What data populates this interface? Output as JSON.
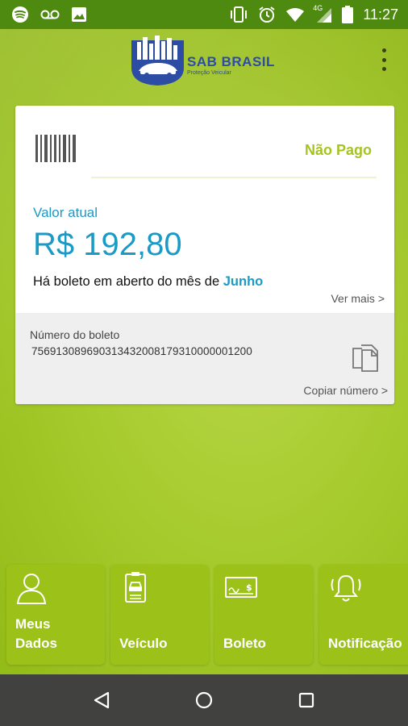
{
  "status_bar": {
    "time": "11:27",
    "signal": "4G",
    "icons_left": [
      "spotify-icon",
      "voicemail-icon",
      "image-icon"
    ],
    "icons_right": [
      "vibrate-icon",
      "alarm-icon",
      "wifi-icon",
      "signal-icon",
      "battery-icon"
    ]
  },
  "header": {
    "logo_text": "SAB BRASIL",
    "logo_subtitle": "Proteção Veicular"
  },
  "card": {
    "status": "Não Pago",
    "valor_label": "Valor atual",
    "valor_amount": "R$ 192,80",
    "message_prefix": "Há boleto em aberto do mês de",
    "message_month": "Junho",
    "ver_mais": "Ver mais >",
    "boleto_label": "Número do boleto",
    "boleto_number": "75691308969031343200817931000000120​0",
    "copiar": "Copiar número >"
  },
  "nav_tiles": [
    {
      "label_line1": "Meus",
      "label_line2": "Dados",
      "icon": "user-icon"
    },
    {
      "label_line1": "",
      "label_line2": "Veículo",
      "icon": "vehicle-card-icon"
    },
    {
      "label_line1": "",
      "label_line2": "Boleto",
      "icon": "check-payment-icon"
    },
    {
      "label_line1": "",
      "label_line2": "Notificação",
      "icon": "bell-icon"
    }
  ],
  "colors": {
    "accent_blue": "#1a9ac6",
    "status_green": "#a6c420",
    "tile_green": "#9cc21a",
    "status_bar": "#4f8a10"
  }
}
